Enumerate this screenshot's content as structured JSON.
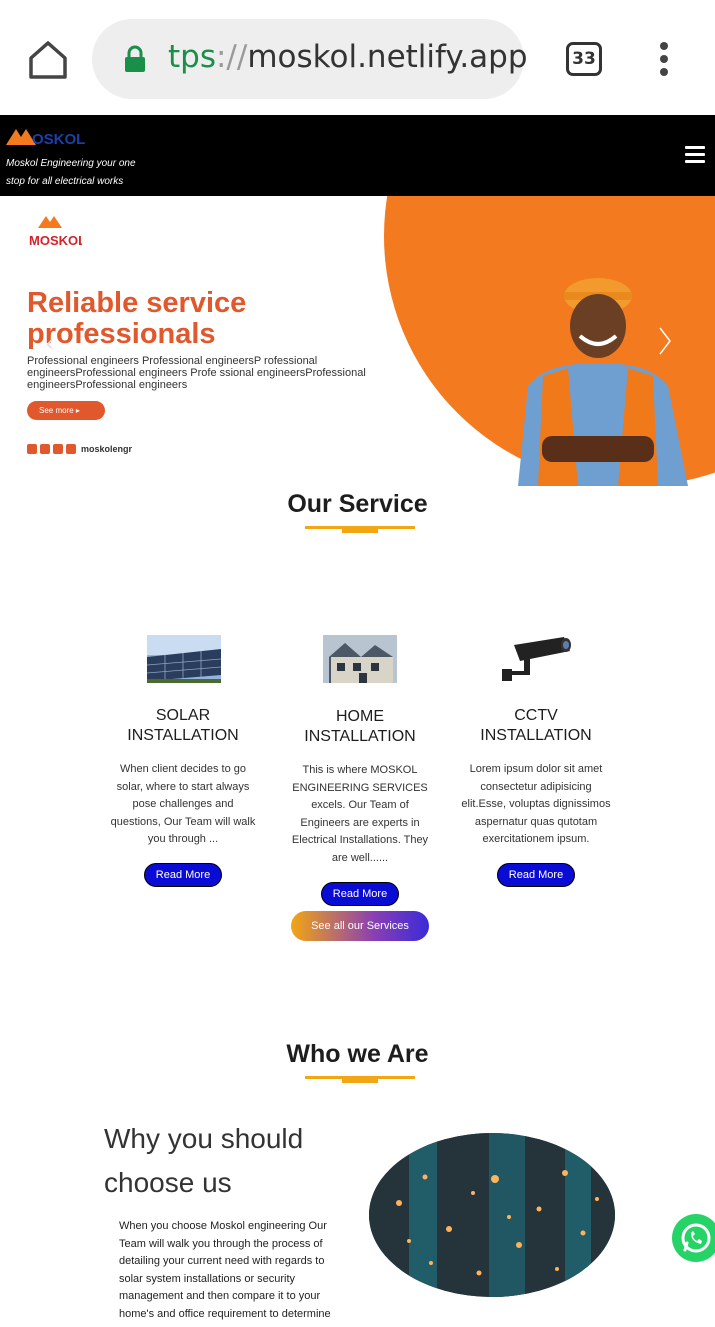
{
  "browser": {
    "url_scheme": "tps",
    "url_sep": "://",
    "url_host": "moskol.netlify.app",
    "tab_count": "33"
  },
  "site": {
    "logo_text": "MOSKOL",
    "tagline": "Moskol Engineering your one stop for all electrical works"
  },
  "hero": {
    "brand": "MOSKOL",
    "title_line1": "Reliable service",
    "title_line2": "professionals",
    "subtitle": "Professional engineers Professional engineersP rofessional engineersProfessional engineers Profe ssional engineersProfessional engineersProfessional engineers",
    "cta": "See more",
    "handle": "moskolengr",
    "accent_color": "#f47a1f"
  },
  "services_section": {
    "title": "Our Service",
    "items": [
      {
        "title": "SOLAR INSTALLATION",
        "description": "When client decides to go solar, where to start always pose challenges and questions, Our Team will walk you through ...",
        "button": "Read More",
        "icon": "solar-panel-image"
      },
      {
        "title": "HOME INSTALLATION",
        "description": "This is where MOSKOL ENGINEERING SERVICES excels. Our Team of Engineers are experts in Electrical Installations. They are well......",
        "button": "Read More",
        "icon": "house-image"
      },
      {
        "title": "CCTV INSTALLATION",
        "description": "Lorem ipsum dolor sit amet consectetur adipisicing elit.Esse, voluptas dignissimos aspernatur quas qutotam exercitationem ipsum.",
        "button": "Read More",
        "icon": "cctv-camera-image"
      }
    ],
    "all_button": "See all our Services"
  },
  "who_section": {
    "title": "Who we Are",
    "why_title": "Why you should choose us",
    "why_text": "When you choose Moskol engineering Our Team will walk you through the process of detailing your current need with regards to solar system installations or security management and then compare it to your home's and office requirement to determine"
  },
  "colors": {
    "brand_blue": "#0b0bd6",
    "accent_orange": "#f2a614",
    "whatsapp": "#25d366"
  }
}
